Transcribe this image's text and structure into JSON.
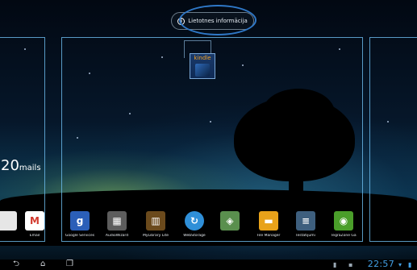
{
  "header": {
    "app_info_label": "Lietotnes informācija",
    "info_glyph": "i"
  },
  "widgets": {
    "kindle_label": "kindle",
    "mails_count": "20",
    "mails_word": "mails"
  },
  "dock": {
    "apps": [
      {
        "label": "",
        "icon": "partial-app-icon",
        "color": "#e0e0e0"
      },
      {
        "label": "Email",
        "icon": "gmail-icon",
        "color": "#ffffff"
      },
      {
        "label": "Google Services",
        "icon": "google-plus-icon",
        "color": "#2b5fb8"
      },
      {
        "label": "AudioWizard",
        "icon": "speaker-icon",
        "color": "#6a6a6a"
      },
      {
        "label": "MyLibrary Lite",
        "icon": "books-icon",
        "color": "#6b4a1c"
      },
      {
        "label": "WebStorage",
        "icon": "cloud-sync-icon",
        "color": "#2f8fd8"
      },
      {
        "label": "",
        "icon": "maps-icon",
        "color": "#5a8f4e"
      },
      {
        "label": "File Manager",
        "icon": "folder-icon",
        "color": "#e8a21a"
      },
      {
        "label": "Iestatījumi",
        "icon": "settings-sliders-icon",
        "color": "#3e5f7e"
      },
      {
        "label": "TegraZone Ga",
        "icon": "nvidia-icon",
        "color": "#4a9e2a"
      }
    ]
  },
  "statusbar": {
    "clock": "22:57",
    "accent": "#43a0e6"
  },
  "navbar": {
    "back_glyph": "⮌",
    "home_glyph": "⌂",
    "recents_glyph": "❐"
  }
}
